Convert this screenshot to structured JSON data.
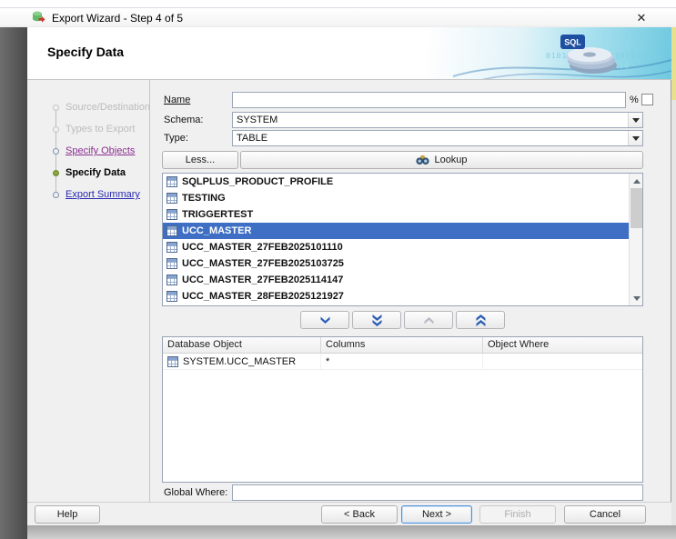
{
  "window": {
    "title": "Export Wizard - Step 4 of 5",
    "close_glyph": "✕"
  },
  "header": {
    "title": "Specify Data",
    "logo_text": "SQL",
    "binary_line1": "0101010101010101010101",
    "binary_line2": "01010101010"
  },
  "steps": [
    {
      "label": "Source/Destination",
      "state": "disabled"
    },
    {
      "label": "Types to Export",
      "state": "disabled"
    },
    {
      "label": "Specify Objects",
      "state": "visited-link"
    },
    {
      "label": "Specify Data",
      "state": "current"
    },
    {
      "label": "Export Summary",
      "state": "link"
    }
  ],
  "form": {
    "name_label": "Name",
    "name_value": "",
    "percent_label": "%",
    "filter_checkbox_checked": false,
    "schema_label": "Schema:",
    "schema_value": "SYSTEM",
    "type_label": "Type:",
    "type_value": "TABLE",
    "less_button": "Less...",
    "lookup_button": "Lookup"
  },
  "object_list": {
    "selected_index": 3,
    "items": [
      "SQLPLUS_PRODUCT_PROFILE",
      "TESTING",
      "TRIGGERTEST",
      "UCC_MASTER",
      "UCC_MASTER_27FEB2025101110",
      "UCC_MASTER_27FEB2025103725",
      "UCC_MASTER_27FEB2025114147",
      "UCC_MASTER_28FEB2025121927"
    ]
  },
  "selected_objects_table": {
    "columns": [
      "Database Object",
      "Columns",
      "Object Where"
    ],
    "rows": [
      {
        "database_object": "SYSTEM.UCC_MASTER",
        "columns": "*",
        "object_where": ""
      }
    ]
  },
  "global_where": {
    "label": "Global Where:",
    "value": ""
  },
  "footer": {
    "help": "Help",
    "back": "< Back",
    "next": "Next >",
    "finish": "Finish",
    "cancel": "Cancel"
  },
  "colors": {
    "selection_bg": "#3e6fc4",
    "selection_text": "#ffffff",
    "visited_link": "#8b2f8f",
    "link": "#2a2ab0",
    "disabled_text": "#bcbcbc",
    "banner_teal": "#6fc9e0",
    "current_step_bullet": "#8aa33c"
  }
}
